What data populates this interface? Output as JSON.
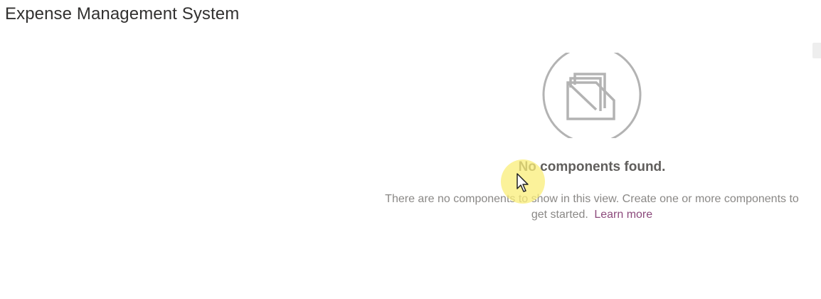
{
  "header": {
    "title": "Expense Management System"
  },
  "empty_state": {
    "icon": "folder-icon",
    "heading": "No components found.",
    "description": "There are no components to show in this view. Create one or more components to get started.",
    "link_label": "Learn more"
  },
  "colors": {
    "title": "#323130",
    "heading": "#605e5c",
    "description": "#8a8886",
    "link": "#8c4a7c",
    "icon_stroke": "#b3b3b3",
    "cursor_highlight": "#faee78"
  }
}
